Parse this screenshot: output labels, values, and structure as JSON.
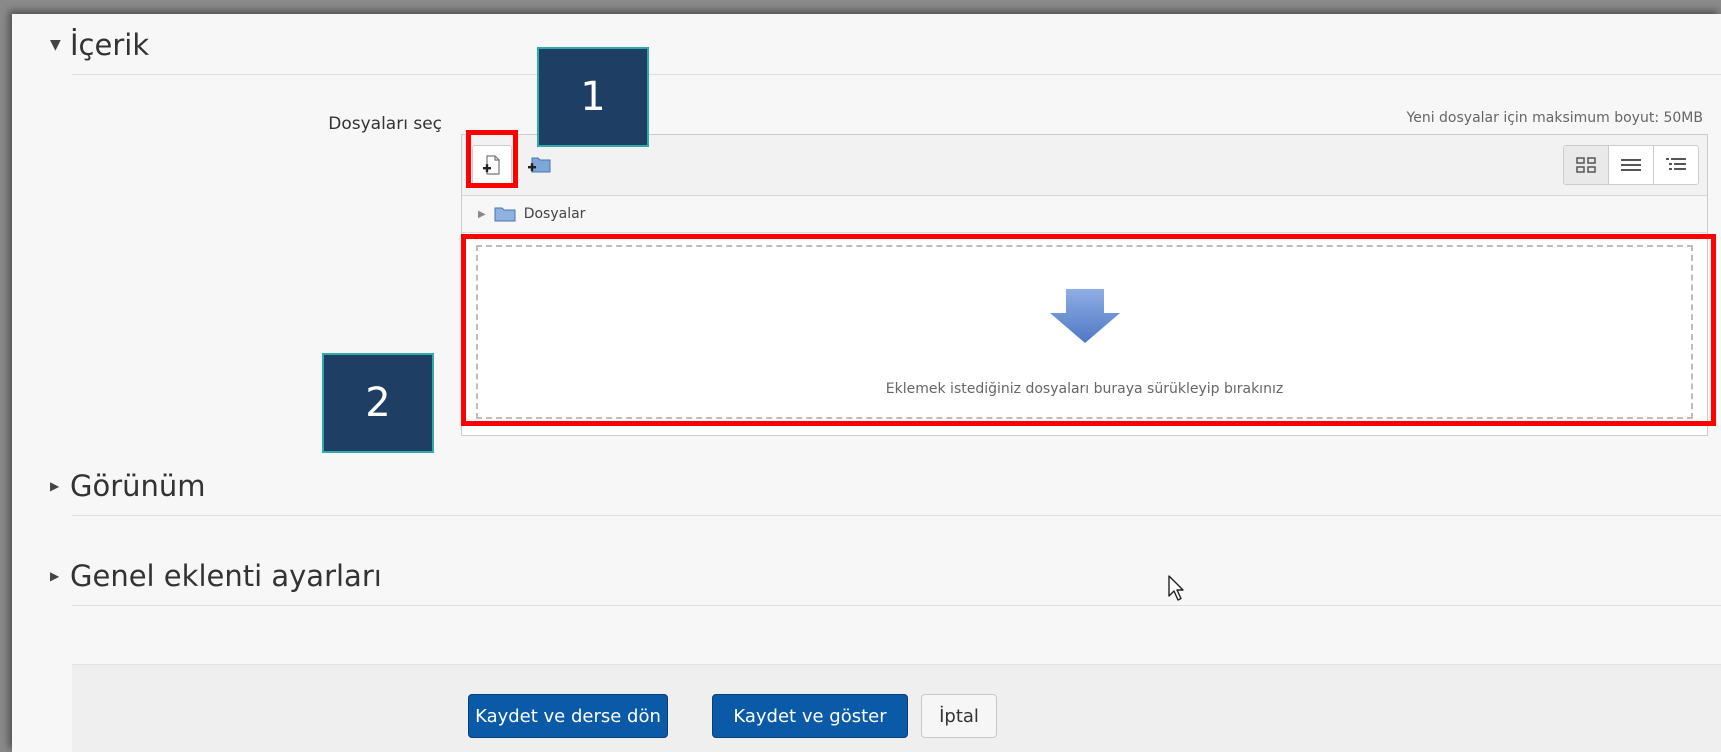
{
  "sections": {
    "content": {
      "title": "İçerik",
      "expanded": true
    },
    "appearance": {
      "title": "Görünüm",
      "expanded": false
    },
    "common_module": {
      "title": "Genel eklenti ayarları",
      "expanded": false
    }
  },
  "file_picker": {
    "label": "Dosyaları seç",
    "max_size_text": "Yeni dosyalar için maksimum boyut: 50MB",
    "toolbar": {
      "add_file_icon": "add-file-icon",
      "create_folder_icon": "create-folder-icon",
      "views": [
        "icons-view-icon",
        "list-view-icon",
        "tree-view-icon"
      ]
    },
    "path": "Dosyalar",
    "drop_text": "Eklemek istediğiniz dosyaları buraya sürükleyip bırakınız"
  },
  "callouts": {
    "one": "1",
    "two": "2"
  },
  "buttons": {
    "save_return": "Kaydet ve derse dön",
    "save_display": "Kaydet ve göster",
    "cancel": "İptal"
  },
  "colors": {
    "primary_button": "#0a5aa8",
    "highlight": "#ff0000",
    "callout_bg": "#1f3e64",
    "callout_border": "#2fa9a9"
  }
}
